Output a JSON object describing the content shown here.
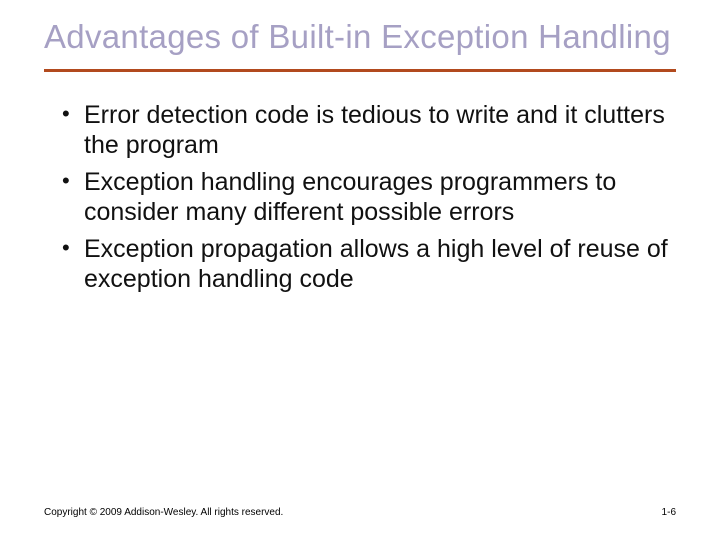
{
  "title": "Advantages of Built-in Exception Handling",
  "bullets": [
    "Error detection code is tedious to write and it clutters the program",
    "Exception handling encourages programmers to consider many different possible errors",
    "Exception propagation allows a high level of reuse of exception handling code"
  ],
  "footer": {
    "copyright": "Copyright © 2009 Addison-Wesley. All rights reserved.",
    "page": "1-6"
  }
}
